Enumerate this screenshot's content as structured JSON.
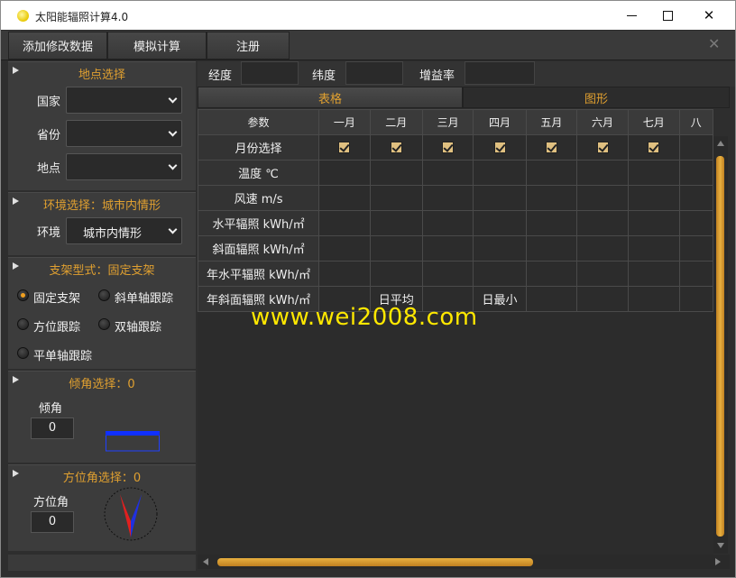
{
  "window": {
    "title": "太阳能辐照计算4.0",
    "controls": {
      "minimize": "minimize",
      "maximize": "maximize",
      "close": "✕"
    }
  },
  "menu": {
    "items": [
      "添加修改数据",
      "模拟计算",
      "注册"
    ],
    "close_glyph": "✕"
  },
  "location": {
    "title": "地点选择",
    "country_label": "国家",
    "country_value": "",
    "province_label": "省份",
    "province_value": "",
    "place_label": "地点",
    "place_value": ""
  },
  "environment": {
    "title": "环境选择：城市内情形",
    "label": "环境",
    "value": "城市内情形"
  },
  "mount": {
    "title": "支架型式：固定支架",
    "options": [
      "固定支架",
      "斜单轴跟踪",
      "方位跟踪",
      "双轴跟踪",
      "平单轴跟踪"
    ],
    "selected": "固定支架"
  },
  "tilt": {
    "title": "倾角选择：0",
    "label": "倾角",
    "value": "0"
  },
  "azimuth": {
    "title": "方位角选择：0",
    "label": "方位角",
    "value": "0"
  },
  "params_bar": {
    "longitude_label": "经度",
    "longitude_value": "",
    "latitude_label": "纬度",
    "latitude_value": "",
    "gain_label": "增益率",
    "gain_value": ""
  },
  "tabs": {
    "table": "表格",
    "chart": "图形",
    "active": "表格"
  },
  "grid": {
    "columns": [
      "参数",
      "一月",
      "二月",
      "三月",
      "四月",
      "五月",
      "六月",
      "七月",
      "八"
    ],
    "rows": [
      {
        "label": "月份选择",
        "cells": [
          "check",
          "check",
          "check",
          "check",
          "check",
          "check",
          "check",
          ""
        ]
      },
      {
        "label": "温度 ℃",
        "cells": [
          "",
          "",
          "",
          "",
          "",
          "",
          "",
          ""
        ]
      },
      {
        "label": "风速 m/s",
        "cells": [
          "",
          "",
          "",
          "",
          "",
          "",
          "",
          ""
        ]
      },
      {
        "label": "水平辐照 kWh/㎡",
        "cells": [
          "",
          "",
          "",
          "",
          "",
          "",
          "",
          ""
        ]
      },
      {
        "label": "斜面辐照 kWh/㎡",
        "cells": [
          "",
          "",
          "",
          "",
          "",
          "",
          "",
          ""
        ]
      },
      {
        "label": "年水平辐照 kWh/㎡",
        "cells": [
          "",
          "",
          "",
          "",
          "",
          "",
          "",
          ""
        ]
      },
      {
        "label": "年斜面辐照 kWh/㎡",
        "cells": [
          "",
          "日平均",
          "",
          "日最小",
          "",
          "",
          "",
          ""
        ]
      }
    ]
  },
  "watermark": "www.wei2008.com",
  "colors": {
    "accent": "#e0a030",
    "background": "#2e2e2e",
    "watermark": "#ffe800"
  }
}
